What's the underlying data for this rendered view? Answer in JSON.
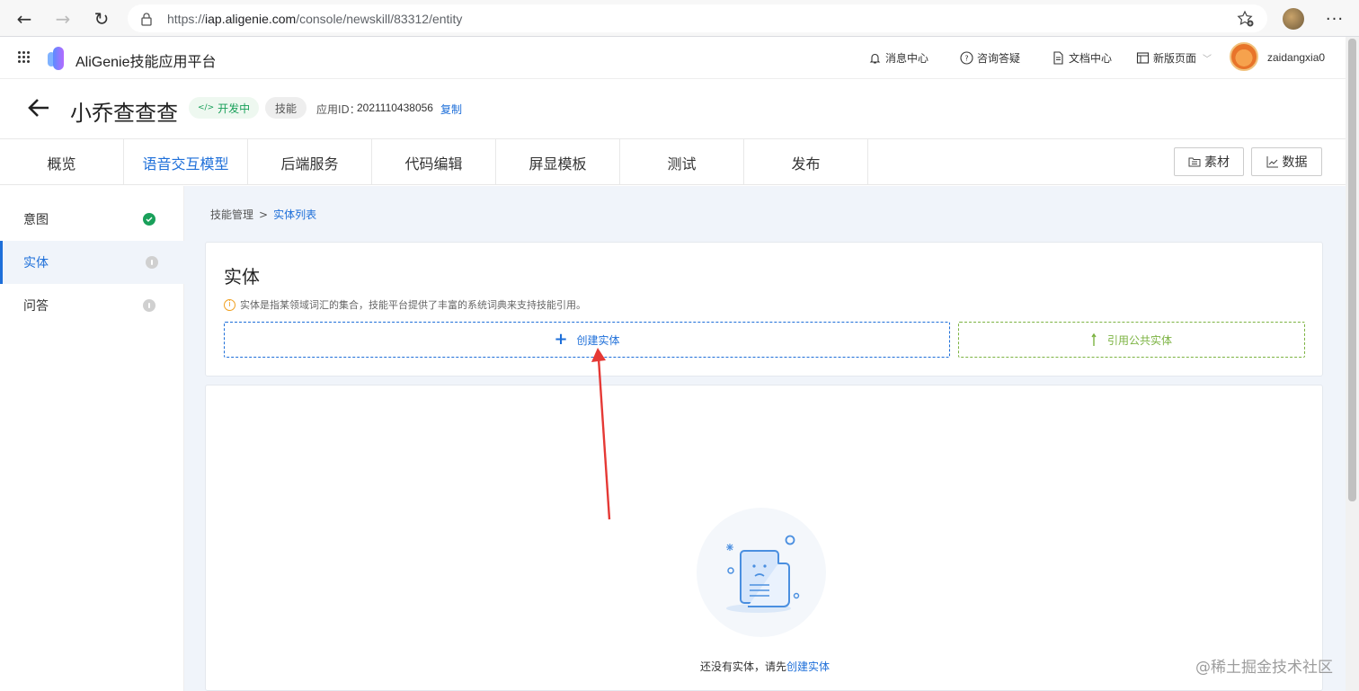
{
  "browser": {
    "url_prefix": "https://",
    "url_host": "iap.aligenie.com",
    "url_path": "/console/newskill/83312/entity"
  },
  "header": {
    "brand": "AliGenie技能应用平台",
    "links": [
      "消息中心",
      "咨询答疑",
      "文档中心",
      "新版页面"
    ],
    "username": "zaidangxia0"
  },
  "title_row": {
    "title": "小乔查查查",
    "status": "开发中",
    "type": "技能",
    "appid_label": "应用ID：",
    "appid": "2021110438056",
    "copy": "复制"
  },
  "tabs": [
    "概览",
    "语音交互模型",
    "后端服务",
    "代码编辑",
    "屏显模板",
    "测试",
    "发布"
  ],
  "active_tab": "语音交互模型",
  "tools": {
    "materials": "素材",
    "data": "数据"
  },
  "sidebar": {
    "items": [
      {
        "label": "意图",
        "status": "done"
      },
      {
        "label": "实体",
        "status": "pending"
      },
      {
        "label": "问答",
        "status": "pending"
      }
    ]
  },
  "breadcrumb": {
    "parent": "技能管理",
    "separator": ">",
    "current": "实体列表"
  },
  "entity_card": {
    "title": "实体",
    "hint": "实体是指某领域词汇的集合，技能平台提供了丰富的系统词典来支持技能引用。",
    "create_label": "创建实体",
    "reference_label": "引用公共实体"
  },
  "empty_state": {
    "text": "还没有实体，请先",
    "link": "创建实体"
  },
  "watermark": "@稀土掘金技术社区",
  "colors": {
    "accent": "#1e6fd9",
    "success": "#19a05a",
    "reference": "#7cb342",
    "annotation": "#e53935"
  }
}
